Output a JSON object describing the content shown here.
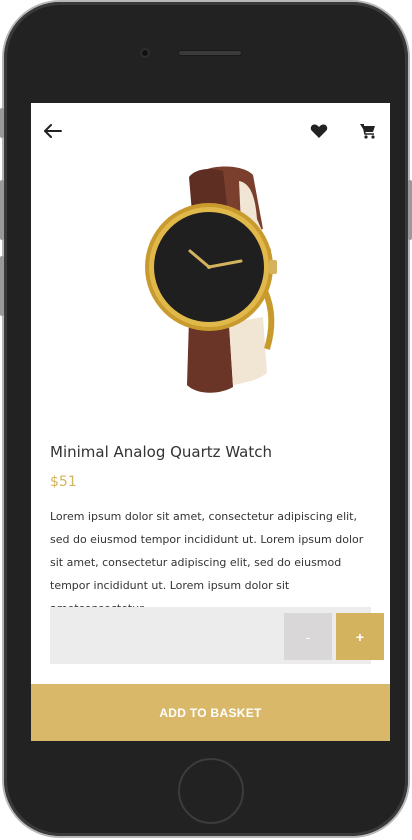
{
  "header": {
    "back_icon": "arrow-left-icon",
    "favorite_icon": "heart-icon",
    "cart_icon": "cart-icon"
  },
  "product": {
    "image_icon": "watch-image",
    "title": "Minimal Analog Quartz Watch",
    "price": "$51",
    "description": "Lorem ipsum dolor sit amet, consectetur adipiscing elit, sed do eiusmod tempor incididunt ut. Lorem ipsum dolor sit amet, consectetur adipiscing elit, sed do eiusmod tempor incididunt ut. Lorem ipsum dolor sit ametconsectetur."
  },
  "quantity": {
    "minus_label": "-",
    "plus_label": "+"
  },
  "actions": {
    "add_to_basket_label": "ADD TO BASKET"
  },
  "colors": {
    "accent": "#d9b969",
    "price": "#d4b35e",
    "qty_bg": "#ececec",
    "minus_bg": "#d9d7d7",
    "phone_frame": "#222222"
  }
}
